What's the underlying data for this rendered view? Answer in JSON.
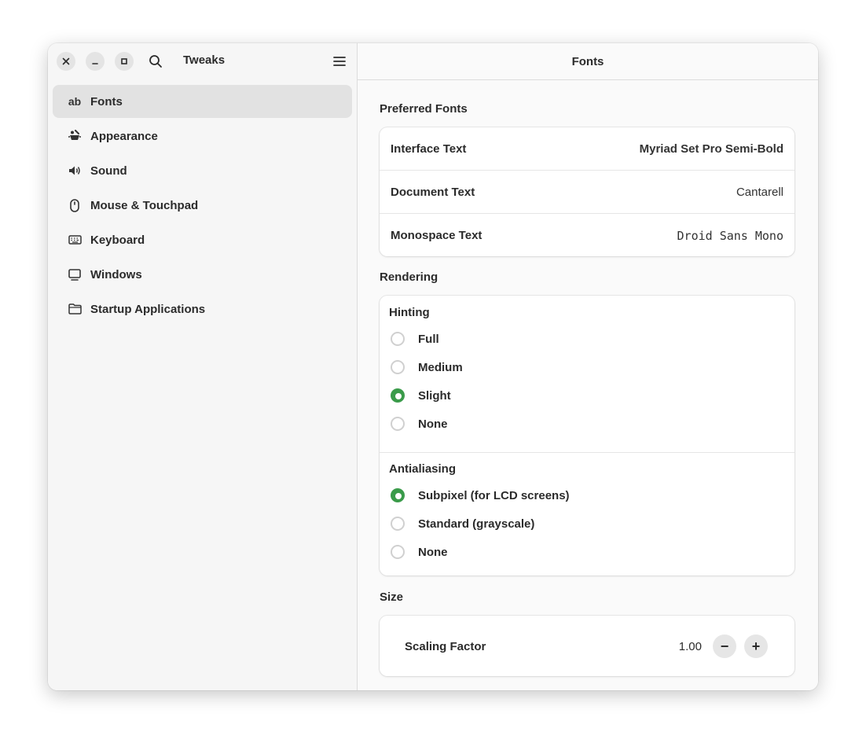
{
  "app": {
    "title": "Tweaks"
  },
  "sidebar": {
    "items": [
      {
        "label": "Fonts",
        "icon": "ab",
        "active": true
      },
      {
        "label": "Appearance",
        "icon": "appearance-icon"
      },
      {
        "label": "Sound",
        "icon": "speaker-icon"
      },
      {
        "label": "Mouse & Touchpad",
        "icon": "mouse-icon"
      },
      {
        "label": "Keyboard",
        "icon": "keyboard-icon"
      },
      {
        "label": "Windows",
        "icon": "monitor-icon"
      },
      {
        "label": "Startup Applications",
        "icon": "folder-icon"
      }
    ]
  },
  "content": {
    "title": "Fonts",
    "preferred": {
      "heading": "Preferred Fonts",
      "rows": [
        {
          "label": "Interface Text",
          "value": "Myriad Set Pro Semi-Bold"
        },
        {
          "label": "Document Text",
          "value": "Cantarell"
        },
        {
          "label": "Monospace Text",
          "value": "Droid Sans Mono"
        }
      ]
    },
    "rendering": {
      "heading": "Rendering",
      "hinting": {
        "title": "Hinting",
        "options": [
          "Full",
          "Medium",
          "Slight",
          "None"
        ],
        "selected": "Slight"
      },
      "antialiasing": {
        "title": "Antialiasing",
        "options": [
          "Subpixel (for LCD screens)",
          "Standard (grayscale)",
          "None"
        ],
        "selected": "Subpixel (for LCD screens)"
      }
    },
    "size": {
      "heading": "Size",
      "label": "Scaling Factor",
      "value": "1.00",
      "minus": "−",
      "plus": "+"
    }
  },
  "colors": {
    "accent": "#3a9b4a",
    "selection": "#e2e2e2"
  }
}
